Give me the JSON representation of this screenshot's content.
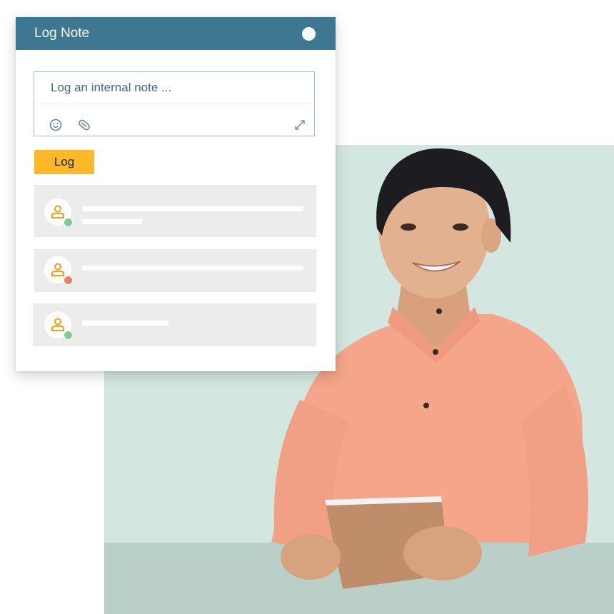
{
  "card": {
    "title": "Log Note",
    "composer": {
      "placeholder": "Log an internal note ...",
      "value": "",
      "tools": [
        "emoji-icon",
        "paperclip-icon",
        "expand-icon"
      ]
    },
    "log_button_label": "Log",
    "messages": [
      {
        "avatar_icon": "user-icon",
        "status": "online",
        "status_color": "#7fcf8a",
        "placeholder_lines": 2
      },
      {
        "avatar_icon": "user-icon",
        "status": "busy",
        "status_color": "#ee7e63",
        "placeholder_lines": 1
      },
      {
        "avatar_icon": "user-icon",
        "status": "online",
        "status_color": "#7fcf8a",
        "placeholder_lines": 1
      }
    ]
  },
  "colors": {
    "header": "#3e7791",
    "accent_button": "#fbb82a",
    "avatar_icon": "#f59e1b",
    "background_panel": "#d3e7e0",
    "background_band": "#bbcfc9"
  },
  "illustration": {
    "subject": "smiling man in salmon shirt holding a tablet"
  }
}
